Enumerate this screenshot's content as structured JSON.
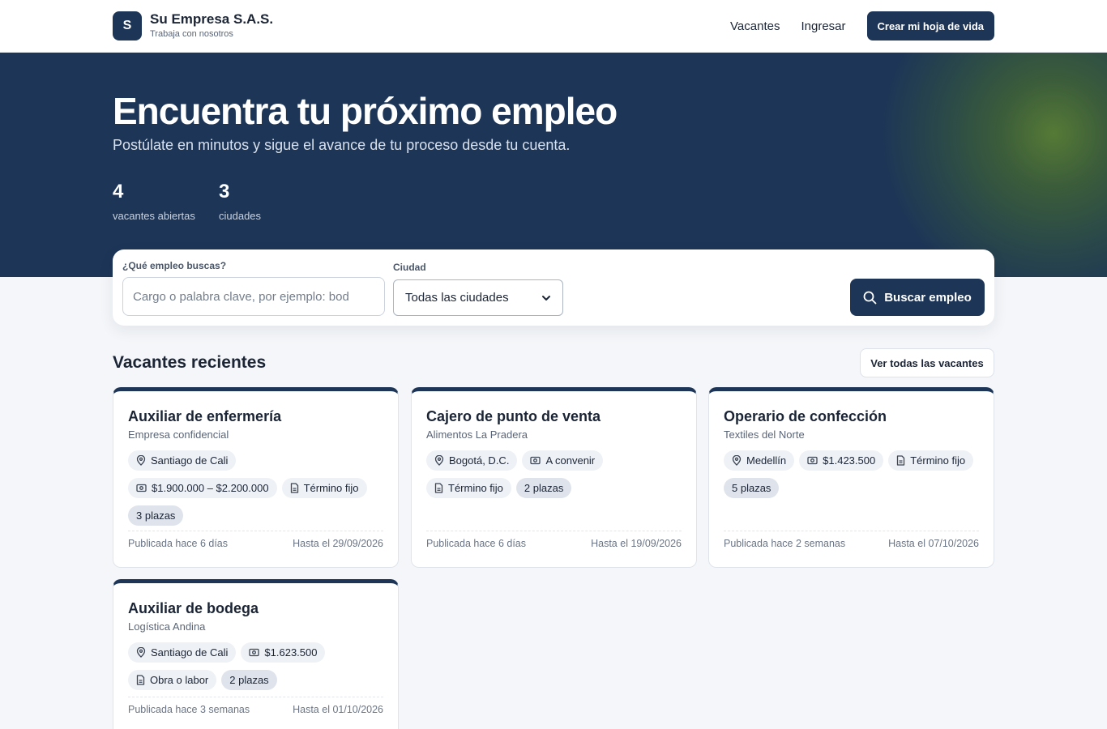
{
  "brand": {
    "logo_letter": "S",
    "name": "Su Empresa S.A.S.",
    "tagline": "Trabaja con nosotros"
  },
  "nav": {
    "vacantes": "Vacantes",
    "ingresar": "Ingresar",
    "cta": "Crear mi hoja de vida"
  },
  "hero": {
    "title": "Encuentra tu próximo empleo",
    "subtitle": "Postúlate en minutos y sigue el avance de tu proceso desde tu cuenta.",
    "stats": [
      {
        "value": "4",
        "label": "vacantes abiertas"
      },
      {
        "value": "3",
        "label": "ciudades"
      }
    ]
  },
  "search": {
    "keyword_label": "¿Qué empleo buscas?",
    "keyword_placeholder": "Cargo o palabra clave, por ejemplo: bod",
    "keyword_value": "",
    "city_label": "Ciudad",
    "city_selected": "Todas las ciudades",
    "button_label": "Buscar empleo"
  },
  "section": {
    "title": "Vacantes recientes",
    "see_all": "Ver todas las vacantes"
  },
  "jobs": [
    {
      "title": "Auxiliar de enfermería",
      "company": "Empresa confidencial",
      "city": "Santiago de Cali",
      "salary": "$1.900.000 – $2.200.000",
      "contract": "Término fijo",
      "openings": "3 plazas",
      "posted": "Publicada hace 6 días",
      "deadline": "Hasta el 29/09/2026"
    },
    {
      "title": "Cajero de punto de venta",
      "company": "Alimentos La Pradera",
      "city": "Bogotá, D.C.",
      "salary": "A convenir",
      "contract": "Término fijo",
      "openings": "2 plazas",
      "posted": "Publicada hace 6 días",
      "deadline": "Hasta el 19/09/2026"
    },
    {
      "title": "Operario de confección",
      "company": "Textiles del Norte",
      "city": "Medellín",
      "salary": "$1.423.500",
      "contract": "Término fijo",
      "openings": "5 plazas",
      "posted": "Publicada hace 2 semanas",
      "deadline": "Hasta el 07/10/2026"
    },
    {
      "title": "Auxiliar de bodega",
      "company": "Logística Andina",
      "city": "Santiago de Cali",
      "salary": "$1.623.500",
      "contract": "Obra o labor",
      "openings": "2 plazas",
      "posted": "Publicada hace 3 semanas",
      "deadline": "Hasta el 01/10/2026"
    }
  ],
  "colors": {
    "primary": "#1d3557",
    "background": "#f4f6f9",
    "chip": "#eef1f5"
  },
  "icons": {
    "search": "search-icon",
    "location": "location-pin-icon",
    "salary": "money-icon",
    "contract": "document-icon",
    "select": "chevron-down-icon"
  }
}
